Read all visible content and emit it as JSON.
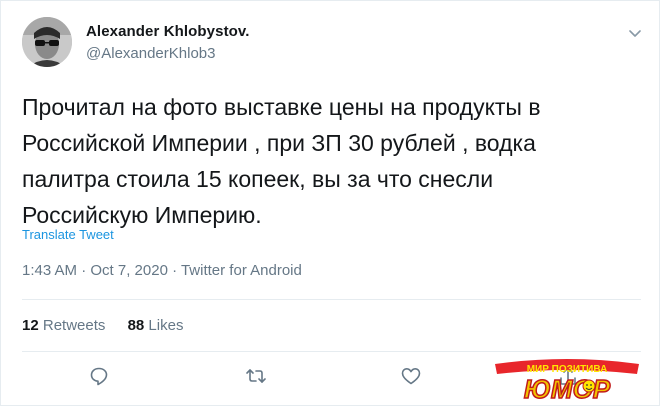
{
  "user": {
    "display_name": "Alexander Khlobystov.",
    "handle": "@AlexanderKhlob3"
  },
  "tweet": {
    "lines": [
      "Прочитал на фото выставке цены на продукты в",
      "Российской Империи , при ЗП 30 рублей , водка",
      "палитра стоила 15 копеек, вы за что снесли",
      "Российскую Империю."
    ],
    "translate_label": "Translate Tweet",
    "timestamp": "1:43 AM · Oct 7, 2020 · Twitter for Android"
  },
  "stats": {
    "retweets_count": "12",
    "retweets_label": "Retweets",
    "likes_count": "88",
    "likes_label": "Likes"
  },
  "actions": [
    "reply-icon",
    "retweet-icon",
    "like-icon",
    "share-icon"
  ],
  "watermark": {
    "top_text": "МИР ПОЗИТИВА",
    "main_text": "ЮМОР"
  },
  "colors": {
    "link": "#1b95e0",
    "muted": "#657786",
    "text": "#14171a",
    "border": "#e6ecf0"
  }
}
